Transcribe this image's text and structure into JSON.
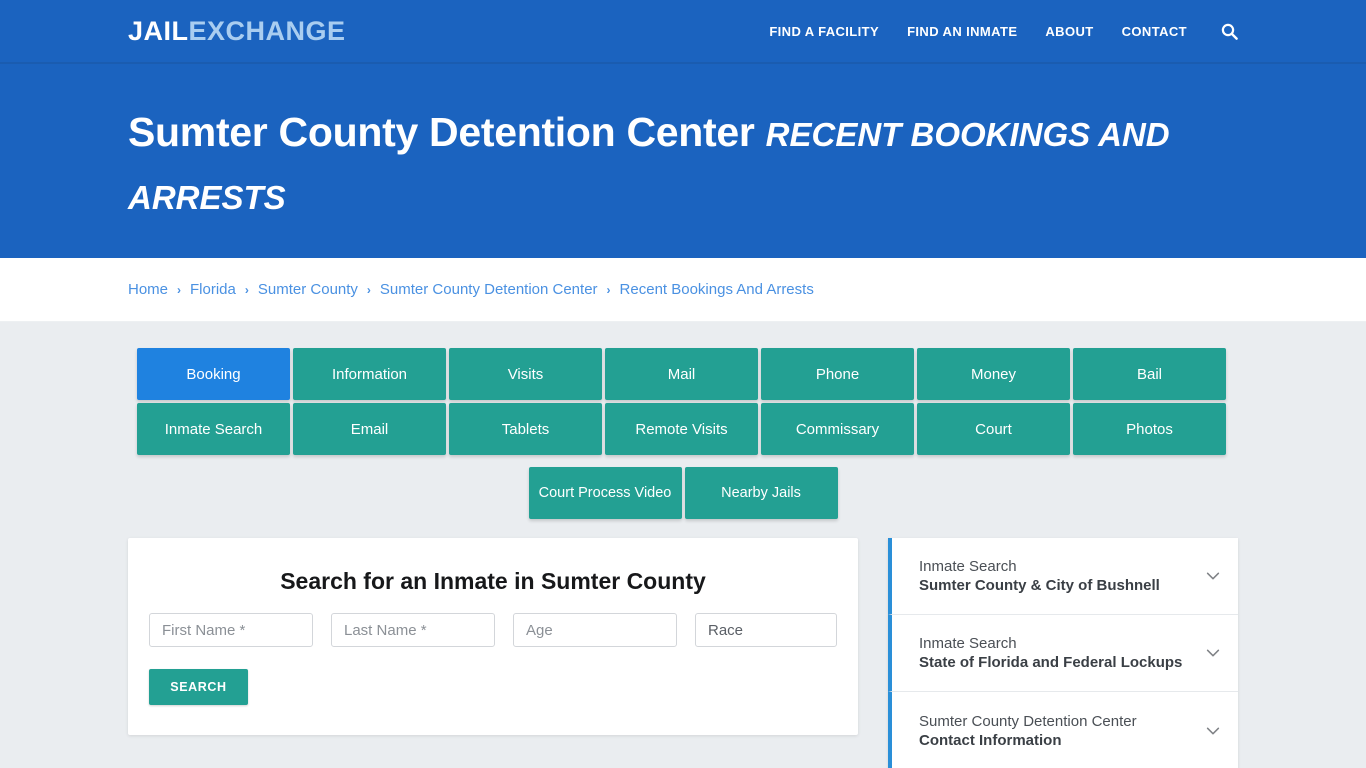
{
  "header": {
    "logo_primary": "JAIL",
    "logo_secondary": "EXCHANGE",
    "nav": [
      {
        "label": "FIND A FACILITY"
      },
      {
        "label": "FIND AN INMATE"
      },
      {
        "label": "ABOUT"
      },
      {
        "label": "CONTACT"
      }
    ],
    "search_icon": "search-icon",
    "brand_color": "#1b63bf"
  },
  "hero": {
    "facility": "Sumter County Detention Center",
    "subtitle": "Recent Bookings and Arrests"
  },
  "breadcrumb": {
    "separator": "›",
    "items": [
      {
        "label": "Home"
      },
      {
        "label": "Florida"
      },
      {
        "label": "Sumter County"
      },
      {
        "label": "Sumter County Detention Center"
      },
      {
        "label": "Recent Bookings And Arrests"
      }
    ]
  },
  "tabs": {
    "active_color": "#1f82e0",
    "default_color": "#23a093",
    "row1": [
      {
        "label": "Booking",
        "active": true
      },
      {
        "label": "Information"
      },
      {
        "label": "Visits"
      },
      {
        "label": "Mail"
      },
      {
        "label": "Phone"
      },
      {
        "label": "Money"
      },
      {
        "label": "Bail"
      }
    ],
    "row2": [
      {
        "label": "Inmate Search"
      },
      {
        "label": "Email"
      },
      {
        "label": "Tablets"
      },
      {
        "label": "Remote Visits"
      },
      {
        "label": "Commissary"
      },
      {
        "label": "Court"
      },
      {
        "label": "Photos"
      }
    ],
    "row3": [
      {
        "label": "Court Process Video"
      },
      {
        "label": "Nearby Jails"
      }
    ]
  },
  "search_form": {
    "title": "Search for an Inmate in Sumter County",
    "first_name_placeholder": "First Name *",
    "first_name_value": "",
    "last_name_placeholder": "Last Name *",
    "last_name_value": "",
    "age_placeholder": "Age",
    "age_value": "",
    "race_selected": "Race",
    "race_options": [
      "Race"
    ],
    "submit_label": "SEARCH"
  },
  "sidebar": {
    "accent_color": "#2a8fd8",
    "items": [
      {
        "line1": "Inmate Search",
        "line2": "Sumter County & City of Bushnell",
        "icon": "chevron-down-icon"
      },
      {
        "line1": "Inmate Search",
        "line2": "State of Florida and Federal Lockups",
        "icon": "chevron-down-icon"
      },
      {
        "line1": "Sumter County Detention Center",
        "line2": "Contact Information",
        "icon": "chevron-down-icon"
      }
    ]
  }
}
